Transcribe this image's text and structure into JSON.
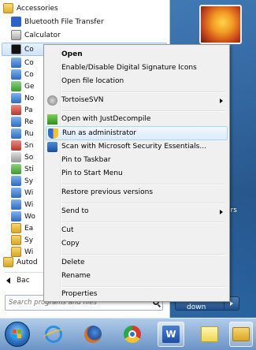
{
  "programs": {
    "items": [
      {
        "label": "Accessories",
        "kind": "folder-open"
      },
      {
        "label": "Bluetooth File Transfer",
        "kind": "bt"
      },
      {
        "label": "Calculator",
        "kind": "calc"
      },
      {
        "label": "Co",
        "kind": "cmd"
      },
      {
        "label": "Co",
        "kind": "blue"
      },
      {
        "label": "Co",
        "kind": "blue"
      },
      {
        "label": "Ge",
        "kind": "green"
      },
      {
        "label": "No",
        "kind": "blue"
      },
      {
        "label": "Pa",
        "kind": "red"
      },
      {
        "label": "Re",
        "kind": "blue"
      },
      {
        "label": "Ru",
        "kind": "blue"
      },
      {
        "label": "Sn",
        "kind": "red"
      },
      {
        "label": "So",
        "kind": "grey"
      },
      {
        "label": "Sti",
        "kind": "green"
      },
      {
        "label": "Sy",
        "kind": "blue"
      },
      {
        "label": "Wi",
        "kind": "blue"
      },
      {
        "label": "Wi",
        "kind": "blue"
      },
      {
        "label": "Wo",
        "kind": "blue"
      },
      {
        "label": "Ea",
        "kind": "folder"
      },
      {
        "label": "Sy",
        "kind": "folder"
      },
      {
        "label": "Wi",
        "kind": "folder"
      },
      {
        "label": "Autod",
        "kind": "folder"
      }
    ],
    "back_label": "Bac",
    "search_placeholder": "Search programs and files"
  },
  "right_panel": {
    "partial_text": "ers",
    "shutdown_label": "Shut down"
  },
  "context_menu": {
    "items": [
      {
        "label": "Open",
        "bold": true
      },
      {
        "label": "Enable/Disable Digital Signature Icons"
      },
      {
        "label": "Open file location"
      },
      {
        "label": "TortoiseSVN",
        "submenu": true
      },
      {
        "label": "Open with JustDecompile"
      },
      {
        "label": "Run as administrator",
        "highlighted": true
      },
      {
        "label": "Scan with Microsoft Security Essentials..."
      },
      {
        "label": "Pin to Taskbar"
      },
      {
        "label": "Pin to Start Menu"
      },
      {
        "label": "Restore previous versions"
      },
      {
        "label": "Send to",
        "submenu": true
      },
      {
        "label": "Cut"
      },
      {
        "label": "Copy"
      },
      {
        "label": "Delete"
      },
      {
        "label": "Rename"
      },
      {
        "label": "Properties"
      }
    ]
  },
  "taskbar": {
    "items": [
      "start-orb",
      "internet-explorer",
      "firefox",
      "chrome",
      "word",
      "sticky-notes",
      "windows-explorer"
    ]
  }
}
